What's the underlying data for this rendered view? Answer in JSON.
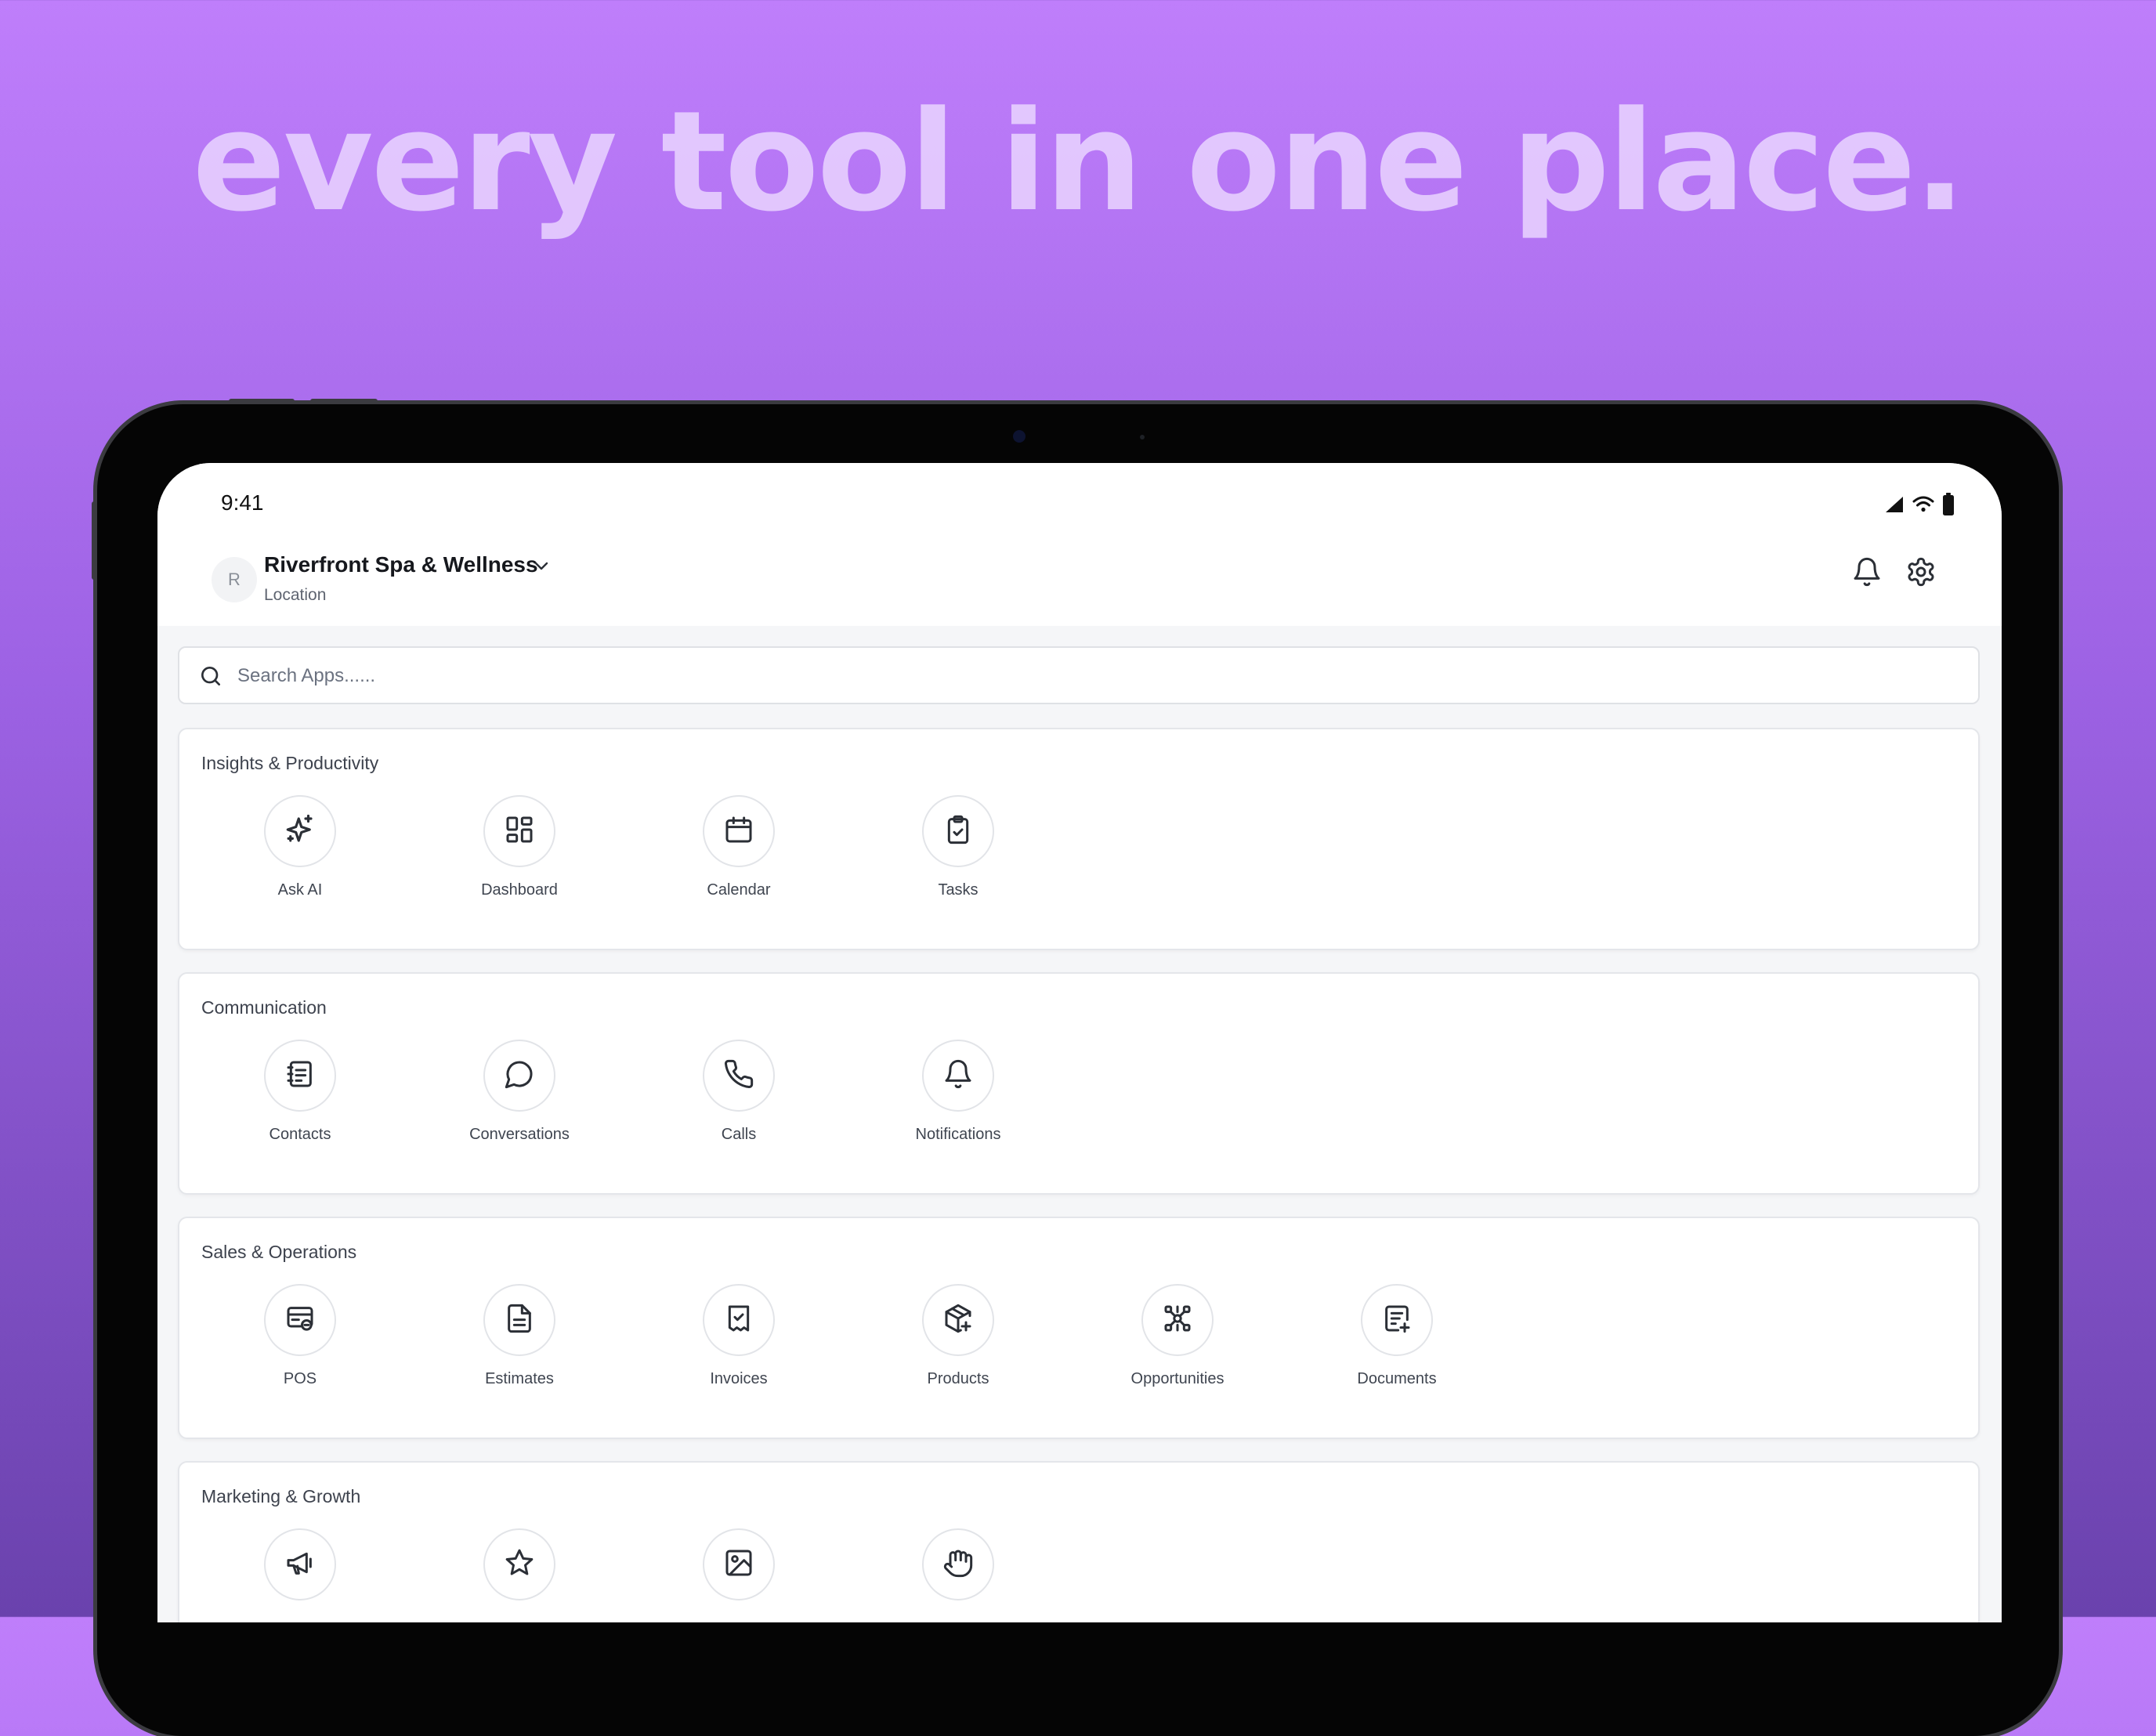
{
  "headline": "every tool in one place.",
  "status_bar": {
    "time": "9:41"
  },
  "header": {
    "avatar_letter": "R",
    "location_name": "Riverfront Spa & Wellness",
    "location_label": "Location"
  },
  "search": {
    "placeholder": "Search Apps......"
  },
  "sections": [
    {
      "title": "Insights & Productivity",
      "apps": [
        {
          "label": "Ask AI",
          "icon": "sparkles-icon"
        },
        {
          "label": "Dashboard",
          "icon": "dashboard-icon"
        },
        {
          "label": "Calendar",
          "icon": "calendar-icon"
        },
        {
          "label": "Tasks",
          "icon": "clipboard-check-icon"
        }
      ]
    },
    {
      "title": "Communication",
      "apps": [
        {
          "label": "Contacts",
          "icon": "contact-book-icon"
        },
        {
          "label": "Conversations",
          "icon": "chat-bubble-icon"
        },
        {
          "label": "Calls",
          "icon": "phone-icon"
        },
        {
          "label": "Notifications",
          "icon": "bell-icon"
        }
      ]
    },
    {
      "title": "Sales & Operations",
      "apps": [
        {
          "label": "POS",
          "icon": "pos-terminal-icon"
        },
        {
          "label": "Estimates",
          "icon": "file-text-icon"
        },
        {
          "label": "Invoices",
          "icon": "receipt-check-icon"
        },
        {
          "label": "Products",
          "icon": "package-plus-icon"
        },
        {
          "label": "Opportunities",
          "icon": "network-icon"
        },
        {
          "label": "Documents",
          "icon": "document-plus-icon"
        }
      ]
    },
    {
      "title": "Marketing & Growth",
      "apps": [
        {
          "label": "",
          "icon": "megaphone-icon"
        },
        {
          "label": "",
          "icon": "star-icon"
        },
        {
          "label": "",
          "icon": "image-icon"
        },
        {
          "label": "",
          "icon": "hand-icon"
        }
      ]
    }
  ],
  "colors": {
    "background_top": "#bf7efb",
    "background_bottom": "#6a42ad",
    "icon_stroke": "#2b2f36"
  }
}
